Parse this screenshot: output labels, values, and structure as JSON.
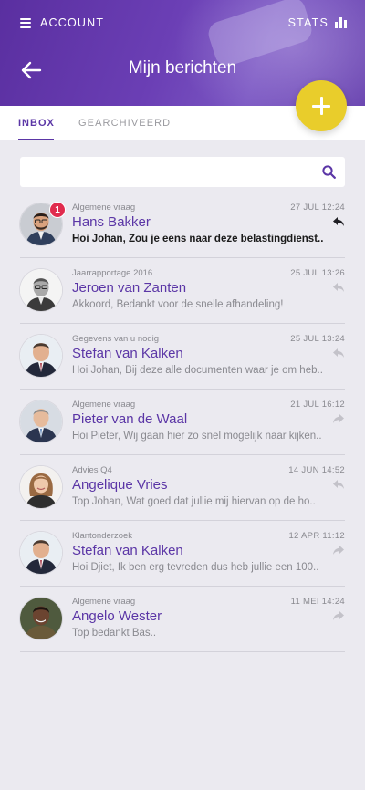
{
  "header": {
    "menu_label": "ACCOUNT",
    "stats_label": "STATS",
    "title": "Mijn berichten",
    "accent": "#5b36a6",
    "fab_color": "#e9cd2b"
  },
  "tabs": [
    {
      "label": "INBOX",
      "active": true
    },
    {
      "label": "GEARCHIVEERD",
      "active": false
    }
  ],
  "search": {
    "placeholder": "",
    "value": ""
  },
  "messages": [
    {
      "subject": "Algemene vraag",
      "date": "27 JUL 12:24",
      "sender": "Hans Bakker",
      "preview": "Hoi Johan, Zou je eens naar deze belastingdienst..",
      "unread": true,
      "badge": "1",
      "action": "reply-dark",
      "avatar": "man-glasses-beard"
    },
    {
      "subject": "Jaarrapportage 2016",
      "date": "25 JUL 13:26",
      "sender": "Jeroen van Zanten",
      "preview": "Akkoord, Bedankt voor de snelle afhandeling!",
      "unread": false,
      "action": "reply",
      "avatar": "man-grey-portrait"
    },
    {
      "subject": "Gegevens van u nodig",
      "date": "25 JUL 13:24",
      "sender": "Stefan van Kalken",
      "preview": "Hoi Johan, Bij deze alle documenten waar je om heb..",
      "unread": false,
      "action": "reply",
      "avatar": "man-suit"
    },
    {
      "subject": "Algemene vraag",
      "date": "21 JUL 16:12",
      "sender": "Pieter van de Waal",
      "preview": "Hoi Pieter, Wij gaan hier zo snel mogelijk naar kijken..",
      "unread": false,
      "action": "forward",
      "avatar": "man-suit-blue"
    },
    {
      "subject": "Advies Q4",
      "date": "14 JUN 14:52",
      "sender": "Angelique Vries",
      "preview": "Top Johan, Wat goed dat jullie mij hiervan op de ho..",
      "unread": false,
      "action": "reply",
      "avatar": "woman-smiling"
    },
    {
      "subject": "Klantonderzoek",
      "date": "12 APR 11:12",
      "sender": "Stefan van Kalken",
      "preview": "Hoi Djiet, Ik ben erg tevreden dus heb jullie een 100..",
      "unread": false,
      "action": "forward",
      "avatar": "man-suit"
    },
    {
      "subject": "Algemene vraag",
      "date": "11 MEI 14:24",
      "sender": "Angelo Wester",
      "preview": "Top bedankt Bas..",
      "unread": false,
      "action": "forward",
      "avatar": "man-dark-smiling"
    }
  ]
}
